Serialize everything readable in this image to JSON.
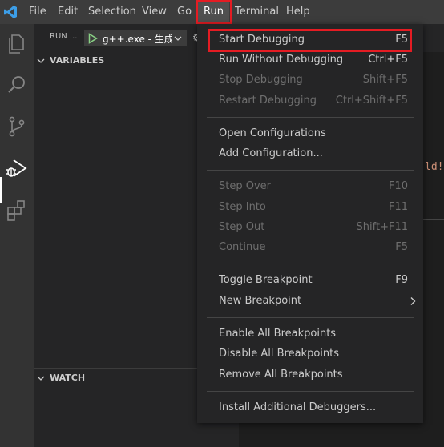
{
  "menubar": {
    "items": [
      {
        "label": "File"
      },
      {
        "label": "Edit"
      },
      {
        "label": "Selection"
      },
      {
        "label": "View"
      },
      {
        "label": "Go"
      },
      {
        "label": "Run"
      },
      {
        "label": "Terminal"
      },
      {
        "label": "Help"
      }
    ],
    "active": "Run"
  },
  "activitybar": {
    "icons": [
      "explorer-icon",
      "search-icon",
      "source-control-icon",
      "run-debug-icon",
      "extensions-icon"
    ],
    "active": "run-debug-icon"
  },
  "sidebar": {
    "run_label": "RUN ...",
    "config_value": "g++.exe - 生成",
    "gear_peek": "⚙",
    "sections": [
      {
        "title": "VARIABLES"
      },
      {
        "title": "WATCH"
      }
    ]
  },
  "editor": {
    "code_peek": "ld!"
  },
  "run_menu": {
    "groups": [
      [
        {
          "label": "Start Debugging",
          "shortcut": "F5",
          "enabled": true,
          "highlighted": true
        },
        {
          "label": "Run Without Debugging",
          "shortcut": "Ctrl+F5",
          "enabled": true
        },
        {
          "label": "Stop Debugging",
          "shortcut": "Shift+F5",
          "enabled": false
        },
        {
          "label": "Restart Debugging",
          "shortcut": "Ctrl+Shift+F5",
          "enabled": false
        }
      ],
      [
        {
          "label": "Open Configurations",
          "shortcut": "",
          "enabled": true
        },
        {
          "label": "Add Configuration...",
          "shortcut": "",
          "enabled": true
        }
      ],
      [
        {
          "label": "Step Over",
          "shortcut": "F10",
          "enabled": false
        },
        {
          "label": "Step Into",
          "shortcut": "F11",
          "enabled": false
        },
        {
          "label": "Step Out",
          "shortcut": "Shift+F11",
          "enabled": false
        },
        {
          "label": "Continue",
          "shortcut": "F5",
          "enabled": false
        }
      ],
      [
        {
          "label": "Toggle Breakpoint",
          "shortcut": "F9",
          "enabled": true
        },
        {
          "label": "New Breakpoint",
          "shortcut": "",
          "enabled": true,
          "submenu": true
        }
      ],
      [
        {
          "label": "Enable All Breakpoints",
          "shortcut": "",
          "enabled": true
        },
        {
          "label": "Disable All Breakpoints",
          "shortcut": "",
          "enabled": true
        },
        {
          "label": "Remove All Breakpoints",
          "shortcut": "",
          "enabled": true
        }
      ],
      [
        {
          "label": "Install Additional Debuggers...",
          "shortcut": "",
          "enabled": true
        }
      ]
    ]
  },
  "colors": {
    "highlight_box": "#e51c23",
    "accent_blue": "#3c9ee8",
    "run_green": "#89d185"
  }
}
